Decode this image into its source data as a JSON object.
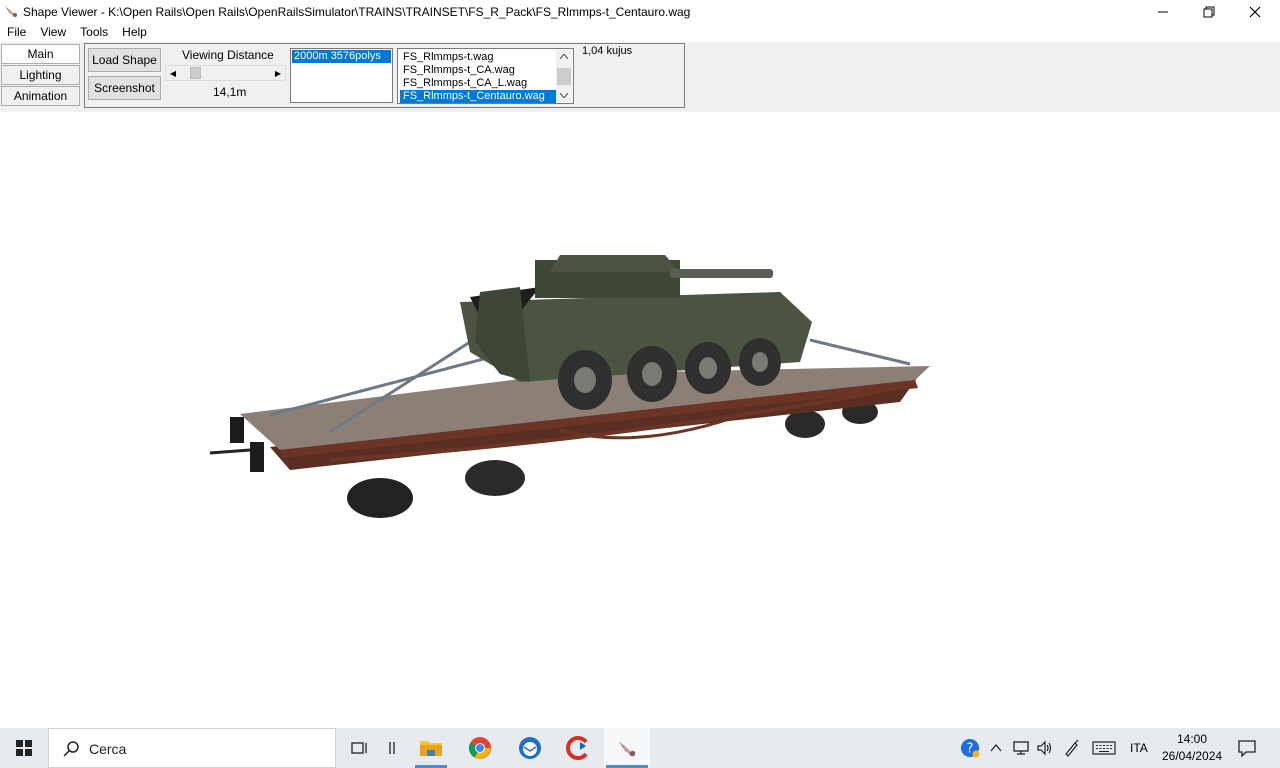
{
  "window": {
    "title": "Shape Viewer - K:\\Open Rails\\Open Rails\\OpenRailsSimulator\\TRAINS\\TRAINSET\\FS_R_Pack\\FS_Rlmmps-t_Centauro.wag"
  },
  "menu": [
    "File",
    "View",
    "Tools",
    "Help"
  ],
  "tabs": [
    "Main",
    "Lighting",
    "Animation"
  ],
  "toolbar": {
    "load_shape": "Load Shape",
    "screenshot": "Screenshot",
    "viewing_distance_label": "Viewing Distance",
    "viewing_distance_value": "14,1m",
    "viewing_distance_fraction": 0.1,
    "lod_items": [
      "2000m 3576polys"
    ],
    "files": [
      "FS_Rlmmps-t.wag",
      "FS_Rlmmps-t_CA.wag",
      "FS_Rlmmps-t_CA_L.wag",
      "FS_Rlmmps-t_Centauro.wag"
    ],
    "selected_file_index": 3,
    "fps": "1,04 kujus"
  },
  "taskbar": {
    "search_placeholder": "Cerca",
    "language": "ITA",
    "time": "14:00",
    "date": "26/04/2024"
  },
  "colors": {
    "selection": "#0078d7",
    "wagon_body": "#6b3526",
    "deck": "#8b7f76",
    "tank": "#4b5443"
  }
}
